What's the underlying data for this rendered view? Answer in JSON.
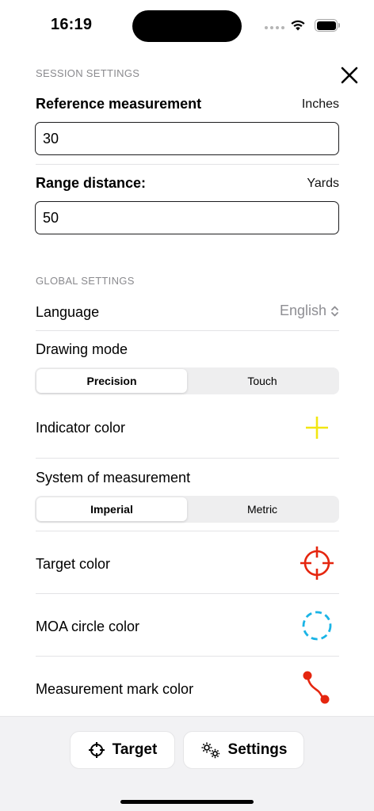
{
  "status": {
    "time": "16:19"
  },
  "session": {
    "header": "SESSION SETTINGS",
    "reference_label": "Reference measurement",
    "reference_unit": "Inches",
    "reference_value": "30",
    "range_label": "Range distance:",
    "range_unit": "Yards",
    "range_value": "50"
  },
  "global": {
    "header": "GLOBAL SETTINGS",
    "language_label": "Language",
    "language_value": "English",
    "drawing_mode_label": "Drawing mode",
    "drawing_mode_options": [
      "Precision",
      "Touch"
    ],
    "drawing_mode_selected": "Precision",
    "indicator_color_label": "Indicator color",
    "system_label": "System of measurement",
    "system_options": [
      "Imperial",
      "Metric"
    ],
    "system_selected": "Imperial",
    "target_color_label": "Target color",
    "moa_color_label": "MOA circle color",
    "mark_color_label": "Measurement mark color"
  },
  "colors": {
    "indicator": "#f2e611",
    "target": "#e5260f",
    "moa_circle": "#1ab4e6",
    "measurement_mark": "#e5260f"
  },
  "tabbar": {
    "target_label": "Target",
    "settings_label": "Settings"
  },
  "icons": [
    "close-icon",
    "chevron-updown-icon",
    "crosshair-icon",
    "gears-icon",
    "wifi-icon",
    "battery-icon",
    "signal-icon"
  ]
}
